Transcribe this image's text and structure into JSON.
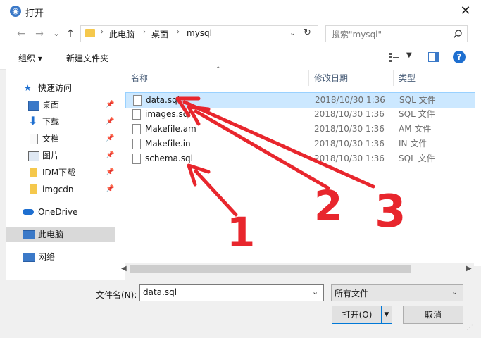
{
  "window": {
    "title": "打开",
    "close_glyph": "✕"
  },
  "nav": {
    "back": "←",
    "forward": "→",
    "dropdown": "⌄",
    "up": "↑",
    "breadcrumb": [
      "此电脑",
      "桌面",
      "mysql"
    ],
    "sep": "›",
    "refresh": "↻",
    "search_placeholder": "搜索\"mysql\""
  },
  "toolbar": {
    "organize": "组织 ▾",
    "new_folder": "新建文件夹",
    "help": "?"
  },
  "sidebar": {
    "quick_access": "快速访问",
    "items": [
      "桌面",
      "下载",
      "文档",
      "图片",
      "IDM下载",
      "imgcdn"
    ],
    "onedrive": "OneDrive",
    "this_pc": "此电脑",
    "network": "网络",
    "pin": "📌"
  },
  "columns": {
    "name": "名称",
    "date": "修改日期",
    "type": "类型"
  },
  "files": [
    {
      "name": "data.sql",
      "date": "2018/10/30 1:36",
      "type": "SQL 文件"
    },
    {
      "name": "images.sql",
      "date": "2018/10/30 1:36",
      "type": "SQL 文件"
    },
    {
      "name": "Makefile.am",
      "date": "2018/10/30 1:36",
      "type": "AM 文件"
    },
    {
      "name": "Makefile.in",
      "date": "2018/10/30 1:36",
      "type": "IN 文件"
    },
    {
      "name": "schema.sql",
      "date": "2018/10/30 1:36",
      "type": "SQL 文件"
    }
  ],
  "bottom": {
    "filename_label": "文件名(N):",
    "filename_value": "data.sql",
    "filter_value": "所有文件",
    "open": "打开(O)",
    "cancel": "取消"
  },
  "annotations": {
    "n1": "1",
    "n2": "2",
    "n3": "3",
    "color": "#e8262d"
  },
  "colors": {
    "accent": "#3b79c8",
    "selection": "#cce8ff"
  }
}
